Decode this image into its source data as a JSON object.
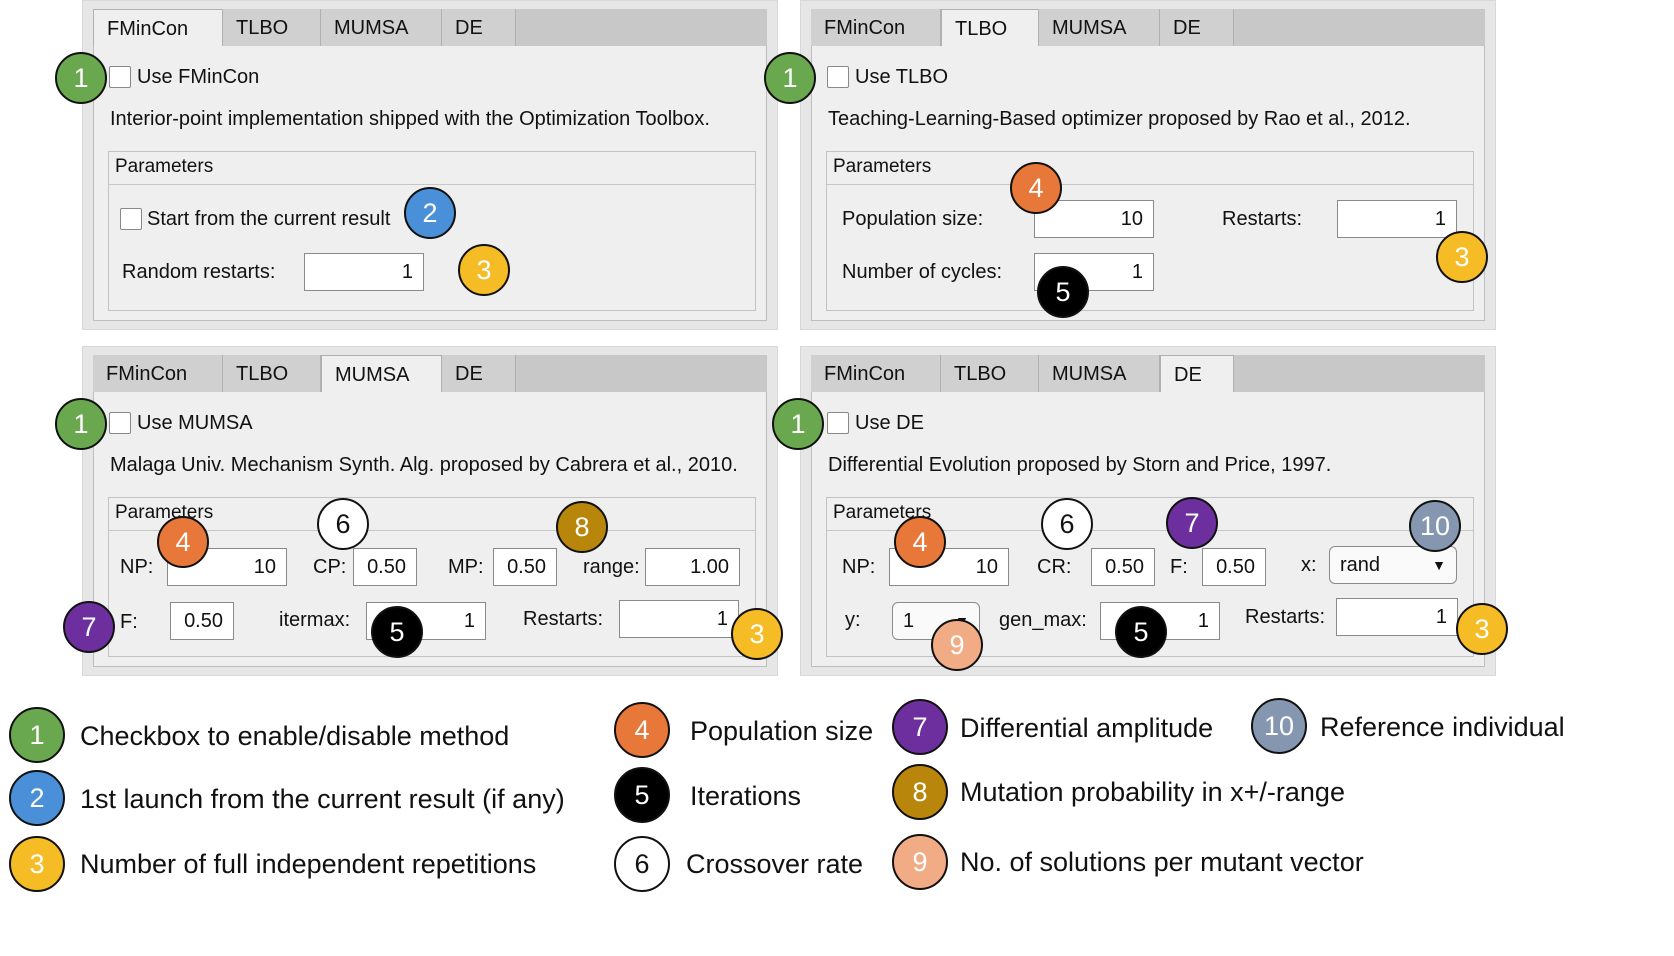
{
  "tabs": [
    "FMinCon",
    "TLBO",
    "MUMSA",
    "DE"
  ],
  "fmincon": {
    "checkbox_label": "Use FMinCon",
    "description": "Interior-point implementation shipped with the Optimization Toolbox.",
    "group_title": "Parameters",
    "start_label": "Start from the current result",
    "restarts_label": "Random restarts:",
    "restarts_value": "1"
  },
  "tlbo": {
    "checkbox_label": "Use TLBO",
    "description": "Teaching-Learning-Based optimizer proposed by Rao et al., 2012.",
    "group_title": "Parameters",
    "pop_label": "Population size:",
    "pop_value": "10",
    "restarts_label": "Restarts:",
    "restarts_value": "1",
    "cycles_label": "Number of cycles:",
    "cycles_value": "1"
  },
  "mumsa": {
    "checkbox_label": "Use MUMSA",
    "description": "Malaga Univ. Mechanism Synth. Alg. proposed by Cabrera et al., 2010.",
    "group_title": "Parameters",
    "np_label": "NP:",
    "np_value": "10",
    "cp_label": "CP:",
    "cp_value": "0.50",
    "mp_label": "MP:",
    "mp_value": "0.50",
    "range_label": "range:",
    "range_value": "1.00",
    "f_label": "F:",
    "f_value": "0.50",
    "itermax_label": "itermax:",
    "itermax_value": "1",
    "restarts_label": "Restarts:",
    "restarts_value": "1"
  },
  "de": {
    "checkbox_label": "Use DE",
    "description": "Differential Evolution proposed by Storn and Price, 1997.",
    "group_title": "Parameters",
    "np_label": "NP:",
    "np_value": "10",
    "cr_label": "CR:",
    "cr_value": "0.50",
    "f_label": "F:",
    "f_value": "0.50",
    "x_label": "x:",
    "x_value": "rand",
    "y_label": "y:",
    "y_value": "1",
    "genmax_label": "gen_max:",
    "genmax_value": "1",
    "restarts_label": "Restarts:",
    "restarts_value": "1"
  },
  "badges": {
    "n1": "1",
    "n2": "2",
    "n3": "3",
    "n4": "4",
    "n5": "5",
    "n6": "6",
    "n7": "7",
    "n8": "8",
    "n9": "9",
    "n10": "10"
  },
  "legend": {
    "l1": "Checkbox to enable/disable method",
    "l2": "1st launch from the current result (if any)",
    "l3": "Number of full independent repetitions",
    "l4": "Population size",
    "l5": "Iterations",
    "l6": "Crossover rate",
    "l7": "Differential amplitude",
    "l8": "Mutation probability in x+/-range",
    "l9": "No. of solutions per mutant vector",
    "l10": "Reference individual"
  },
  "colors": {
    "b1": "#6aa84f",
    "b2": "#4a90d9",
    "b3": "#f6bc26",
    "b4": "#e8773a",
    "b5": "#000000",
    "b6": "#ffffff",
    "b7": "#6e2f9e",
    "b8": "#b8860b",
    "b9": "#f1ab85",
    "b10": "#8597b0"
  }
}
